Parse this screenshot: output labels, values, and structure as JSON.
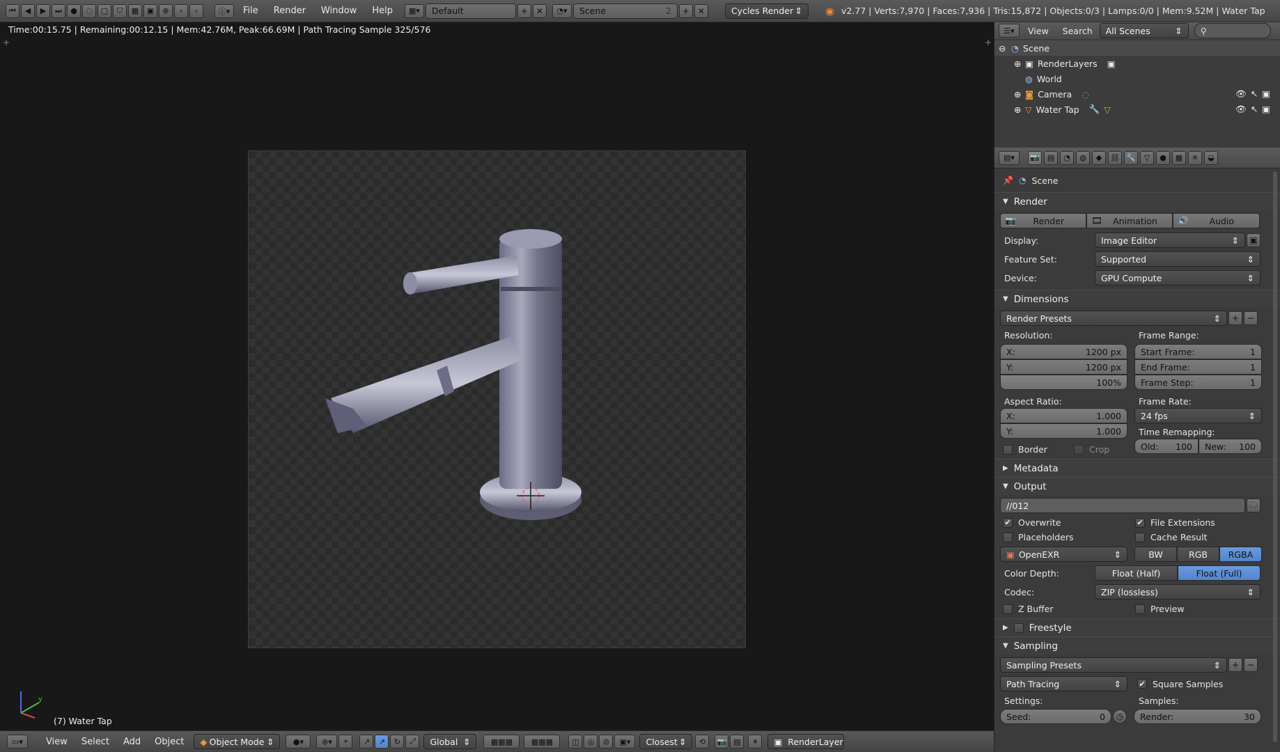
{
  "topbar": {
    "menus": [
      "File",
      "Render",
      "Window",
      "Help"
    ],
    "layout": "Default",
    "scene": "Scene",
    "scene_users": "2",
    "engine": "Cycles Render",
    "stats": "v2.77 | Verts:7,970 | Faces:7,936 | Tris:15,872 | Objects:0/3 | Lamps:0/0 | Mem:9.52M | Water Tap"
  },
  "viewport": {
    "render_info": "Time:00:15.75 | Remaining:00:12.15 | Mem:42.76M, Peak:66.69M | Path Tracing Sample 325/576",
    "object_label": "(7) Water Tap"
  },
  "bottombar": {
    "menus": [
      "View",
      "Select",
      "Add",
      "Object"
    ],
    "mode": "Object Mode",
    "orientation": "Global",
    "snap": "Closest",
    "render_layer": "RenderLayer"
  },
  "outliner": {
    "menus": [
      "View",
      "Search"
    ],
    "filter": "All Scenes",
    "items": [
      {
        "label": "Scene"
      },
      {
        "label": "RenderLayers"
      },
      {
        "label": "World"
      },
      {
        "label": "Camera"
      },
      {
        "label": "Water Tap"
      }
    ]
  },
  "properties": {
    "context": "Scene",
    "render_panel": {
      "title": "Render",
      "buttons": [
        "Render",
        "Animation",
        "Audio"
      ],
      "display_label": "Display:",
      "display": "Image Editor",
      "feature_set_label": "Feature Set:",
      "feature_set": "Supported",
      "device_label": "Device:",
      "device": "GPU Compute"
    },
    "dimensions_panel": {
      "title": "Dimensions",
      "presets": "Render Presets",
      "resolution_label": "Resolution:",
      "res_x_label": "X:",
      "res_x": "1200 px",
      "res_y_label": "Y:",
      "res_y": "1200 px",
      "res_pct": "100%",
      "frame_range_label": "Frame Range:",
      "start_label": "Start Frame:",
      "start": "1",
      "end_label": "End Frame:",
      "end": "1",
      "step_label": "Frame Step:",
      "step": "1",
      "aspect_label": "Aspect Ratio:",
      "aspect_x_label": "X:",
      "aspect_x": "1.000",
      "aspect_y_label": "Y:",
      "aspect_y": "1.000",
      "frame_rate_label": "Frame Rate:",
      "frame_rate": "24 fps",
      "time_remap_label": "Time Remapping:",
      "old_label": "Old:",
      "old": "100",
      "new_label": "New:",
      "new": "100",
      "border": "Border",
      "crop": "Crop"
    },
    "metadata_panel": {
      "title": "Metadata"
    },
    "output_panel": {
      "title": "Output",
      "path": "//012",
      "overwrite": "Overwrite",
      "file_extensions": "File Extensions",
      "placeholders": "Placeholders",
      "cache_result": "Cache Result",
      "format": "OpenEXR",
      "color_modes": [
        "BW",
        "RGB",
        "RGBA"
      ],
      "color_depth_label": "Color Depth:",
      "depths": [
        "Float (Half)",
        "Float (Full)"
      ],
      "codec_label": "Codec:",
      "codec": "ZIP (lossless)",
      "z_buffer": "Z Buffer",
      "preview": "Preview"
    },
    "freestyle_panel": {
      "title": "Freestyle"
    },
    "sampling_panel": {
      "title": "Sampling",
      "presets": "Sampling Presets",
      "integrator": "Path Tracing",
      "square_samples": "Square Samples",
      "settings_label": "Settings:",
      "samples_label": "Samples:",
      "seed_label": "Seed:",
      "seed": "0",
      "render_label": "Render:",
      "render": "30"
    }
  },
  "colors": {
    "accent": "#5680c2",
    "panel": "#3b3b3b",
    "viewport": "#181818"
  }
}
